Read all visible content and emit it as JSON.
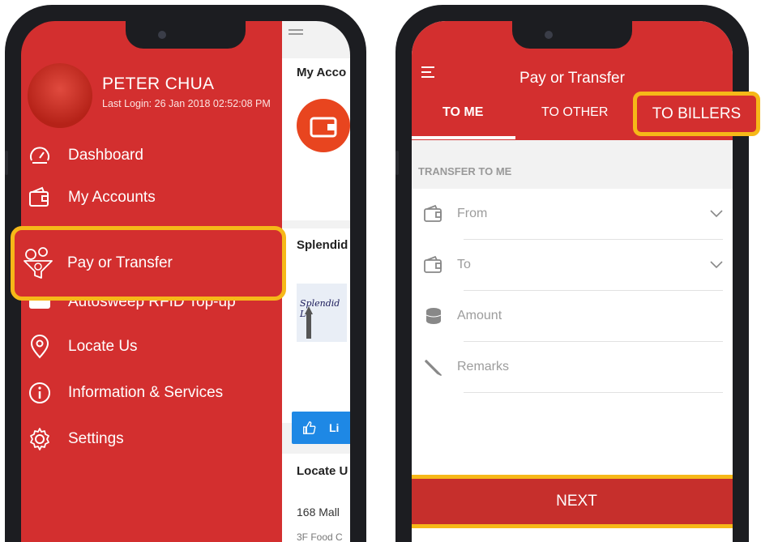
{
  "drawer": {
    "user_name": "PETER CHUA",
    "last_login": "Last Login: 26 Jan 2018 02:52:08 PM",
    "items": [
      {
        "label": "Dashboard",
        "icon": "speedometer-icon"
      },
      {
        "label": "My Accounts",
        "icon": "wallet-icon"
      },
      {
        "label": "Pay or Transfer",
        "icon": "money-funnel-icon"
      },
      {
        "label": "Autosweep RFID Top-up",
        "icon": "rfid-card-icon"
      },
      {
        "label": "Locate Us",
        "icon": "location-pin-icon"
      },
      {
        "label": "Information & Services",
        "icon": "info-icon"
      },
      {
        "label": "Settings",
        "icon": "gear-icon"
      }
    ]
  },
  "background_app": {
    "card1_title": "My Acco",
    "card2_title": "Splendid",
    "promo_text": "Splendid Lo",
    "like_label": "Li",
    "card3_title": "Locate U",
    "location1": "168 Mall",
    "location2": "3F Food C"
  },
  "transfer": {
    "title": "Pay or Transfer",
    "tabs": [
      "TO ME",
      "TO OTHER",
      "TO BILLERS"
    ],
    "section_label": "TRANSFER TO ME",
    "fields": [
      {
        "label": "From",
        "icon": "wallet-icon",
        "dropdown": true
      },
      {
        "label": "To",
        "icon": "wallet-icon",
        "dropdown": true
      },
      {
        "label": "Amount",
        "icon": "coins-icon",
        "dropdown": false
      },
      {
        "label": "Remarks",
        "icon": "pencil-icon",
        "dropdown": false
      }
    ],
    "next_label": "NEXT"
  },
  "colors": {
    "brand_red": "#d32f2f",
    "highlight": "#f6b818"
  }
}
